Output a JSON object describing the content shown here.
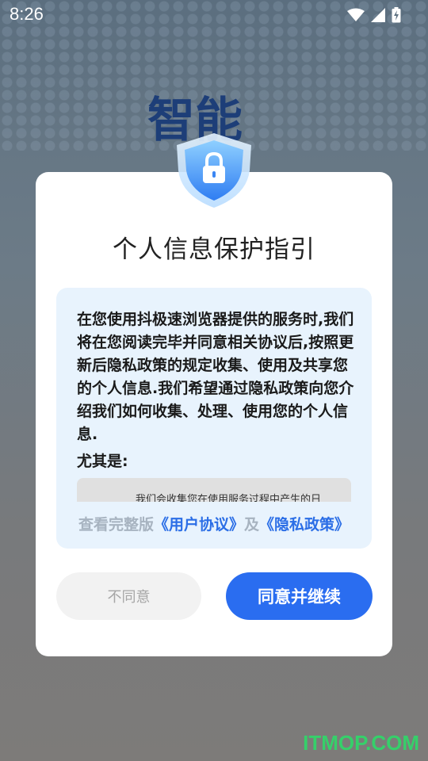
{
  "status_bar": {
    "time": "8:26"
  },
  "background": {
    "headline": "智能"
  },
  "dialog": {
    "title": "个人信息保护指引",
    "body_text": "在您使用抖极速浏览器提供的服务时,我们将在您阅读完毕并同意相关协议后,按照更新后隐私政策的规定收集、使用及共享您的个人信息.我们希望通过隐私政策向您介绍我们如何收集、处理、使用您的个人信息.",
    "emphasis_label": "尤其是:",
    "scroll_card_text": "我们会收集您在使用服务过程中产生的日",
    "agreement": {
      "prefix": "查看完整版",
      "user_agreement": "《用户协议》",
      "conjunction": "及",
      "privacy_policy": "《隐私政策》"
    },
    "buttons": {
      "disagree": "不同意",
      "agree": "同意并继续"
    }
  },
  "watermark": "ITMOP.COM",
  "colors": {
    "accent": "#2a6df0",
    "info_bg": "#e8f3fd",
    "watermark": "#35d06a"
  }
}
